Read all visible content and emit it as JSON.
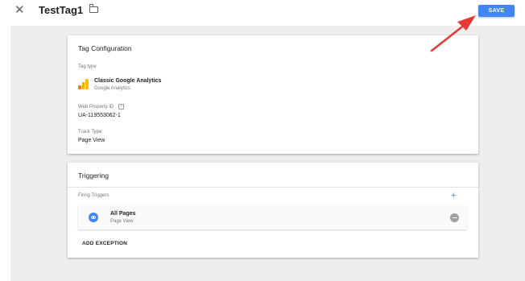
{
  "header": {
    "close_glyph": "✕",
    "title": "TestTag1",
    "save_label": "SAVE"
  },
  "tag_configuration": {
    "title": "Tag Configuration",
    "tag_type_label": "Tag type",
    "tag_type_name": "Classic Google Analytics",
    "tag_type_vendor": "Google Analytics",
    "web_property_label": "Web Property ID",
    "help_glyph": "?",
    "web_property_value": "UA-119553062-1",
    "track_type_label": "Track Type",
    "track_type_value": "Page View"
  },
  "triggering": {
    "title": "Triggering",
    "firing_label": "Firing Triggers",
    "add_glyph": "+",
    "triggers": [
      {
        "name": "All Pages",
        "type": "Page View"
      }
    ],
    "add_exception_label": "ADD EXCEPTION"
  },
  "colors": {
    "accent": "#4285f4",
    "annotation_arrow": "#e53935",
    "canvas_bg": "#eeeeee"
  },
  "icons": [
    "close-icon",
    "folder-icon",
    "google-analytics-icon",
    "help-icon",
    "plus-icon",
    "eye-icon",
    "remove-icon",
    "annotation-arrow"
  ]
}
